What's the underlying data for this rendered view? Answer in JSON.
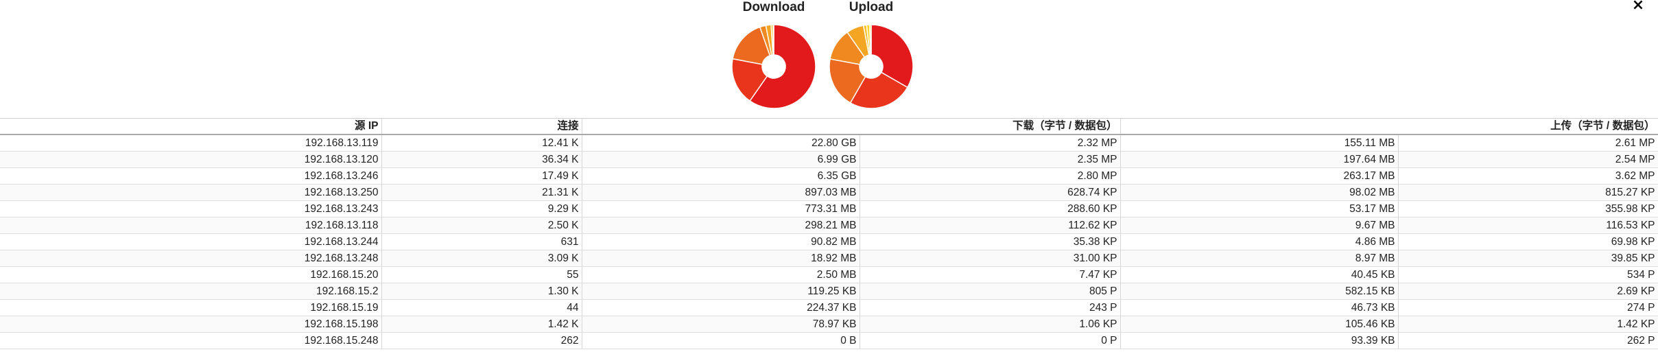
{
  "close_label": "×",
  "pies": {
    "download": {
      "title": "Download",
      "slices": [
        {
          "value": 22.8,
          "color": "#e31a1c"
        },
        {
          "value": 6.99,
          "color": "#e8351c"
        },
        {
          "value": 6.35,
          "color": "#ec6a1f"
        },
        {
          "value": 0.897,
          "color": "#f08a20"
        },
        {
          "value": 0.773,
          "color": "#f4a522"
        },
        {
          "value": 0.298,
          "color": "#f7c025"
        },
        {
          "value": 0.091,
          "color": "#fad528"
        }
      ]
    },
    "upload": {
      "title": "Upload",
      "slices": [
        {
          "value": 263.17,
          "color": "#e31a1c"
        },
        {
          "value": 197.64,
          "color": "#e8351c"
        },
        {
          "value": 155.11,
          "color": "#ec6a1f"
        },
        {
          "value": 98.02,
          "color": "#f08a20"
        },
        {
          "value": 53.17,
          "color": "#f4a522"
        },
        {
          "value": 9.67,
          "color": "#f7c025"
        },
        {
          "value": 8.97,
          "color": "#fad528"
        },
        {
          "value": 4.86,
          "color": "#fde34a"
        }
      ]
    }
  },
  "table": {
    "headers": {
      "src_ip": "源 IP",
      "connections": "连接",
      "download": "下载（字节 / 数据包）",
      "upload": "上传（字节 / 数据包）"
    },
    "rows": [
      {
        "ip": "192.168.13.119",
        "conn": "12.41 K",
        "dl_bytes": "22.80 GB",
        "dl_pkts": "2.32 MP",
        "ul_bytes": "155.11 MB",
        "ul_pkts": "2.61 MP"
      },
      {
        "ip": "192.168.13.120",
        "conn": "36.34 K",
        "dl_bytes": "6.99 GB",
        "dl_pkts": "2.35 MP",
        "ul_bytes": "197.64 MB",
        "ul_pkts": "2.54 MP"
      },
      {
        "ip": "192.168.13.246",
        "conn": "17.49 K",
        "dl_bytes": "6.35 GB",
        "dl_pkts": "2.80 MP",
        "ul_bytes": "263.17 MB",
        "ul_pkts": "3.62 MP"
      },
      {
        "ip": "192.168.13.250",
        "conn": "21.31 K",
        "dl_bytes": "897.03 MB",
        "dl_pkts": "628.74 KP",
        "ul_bytes": "98.02 MB",
        "ul_pkts": "815.27 KP"
      },
      {
        "ip": "192.168.13.243",
        "conn": "9.29 K",
        "dl_bytes": "773.31 MB",
        "dl_pkts": "288.60 KP",
        "ul_bytes": "53.17 MB",
        "ul_pkts": "355.98 KP"
      },
      {
        "ip": "192.168.13.118",
        "conn": "2.50 K",
        "dl_bytes": "298.21 MB",
        "dl_pkts": "112.62 KP",
        "ul_bytes": "9.67 MB",
        "ul_pkts": "116.53 KP"
      },
      {
        "ip": "192.168.13.244",
        "conn": "631",
        "dl_bytes": "90.82 MB",
        "dl_pkts": "35.38 KP",
        "ul_bytes": "4.86 MB",
        "ul_pkts": "69.98 KP"
      },
      {
        "ip": "192.168.13.248",
        "conn": "3.09 K",
        "dl_bytes": "18.92 MB",
        "dl_pkts": "31.00 KP",
        "ul_bytes": "8.97 MB",
        "ul_pkts": "39.85 KP"
      },
      {
        "ip": "192.168.15.20",
        "conn": "55",
        "dl_bytes": "2.50 MB",
        "dl_pkts": "7.47 KP",
        "ul_bytes": "40.45 KB",
        "ul_pkts": "534 P"
      },
      {
        "ip": "192.168.15.2",
        "conn": "1.30 K",
        "dl_bytes": "119.25 KB",
        "dl_pkts": "805 P",
        "ul_bytes": "582.15 KB",
        "ul_pkts": "2.69 KP"
      },
      {
        "ip": "192.168.15.19",
        "conn": "44",
        "dl_bytes": "224.37 KB",
        "dl_pkts": "243 P",
        "ul_bytes": "46.73 KB",
        "ul_pkts": "274 P"
      },
      {
        "ip": "192.168.15.198",
        "conn": "1.42 K",
        "dl_bytes": "78.97 KB",
        "dl_pkts": "1.06 KP",
        "ul_bytes": "105.46 KB",
        "ul_pkts": "1.42 KP"
      },
      {
        "ip": "192.168.15.248",
        "conn": "262",
        "dl_bytes": "0 B",
        "dl_pkts": "0 P",
        "ul_bytes": "93.39 KB",
        "ul_pkts": "262 P"
      }
    ]
  }
}
